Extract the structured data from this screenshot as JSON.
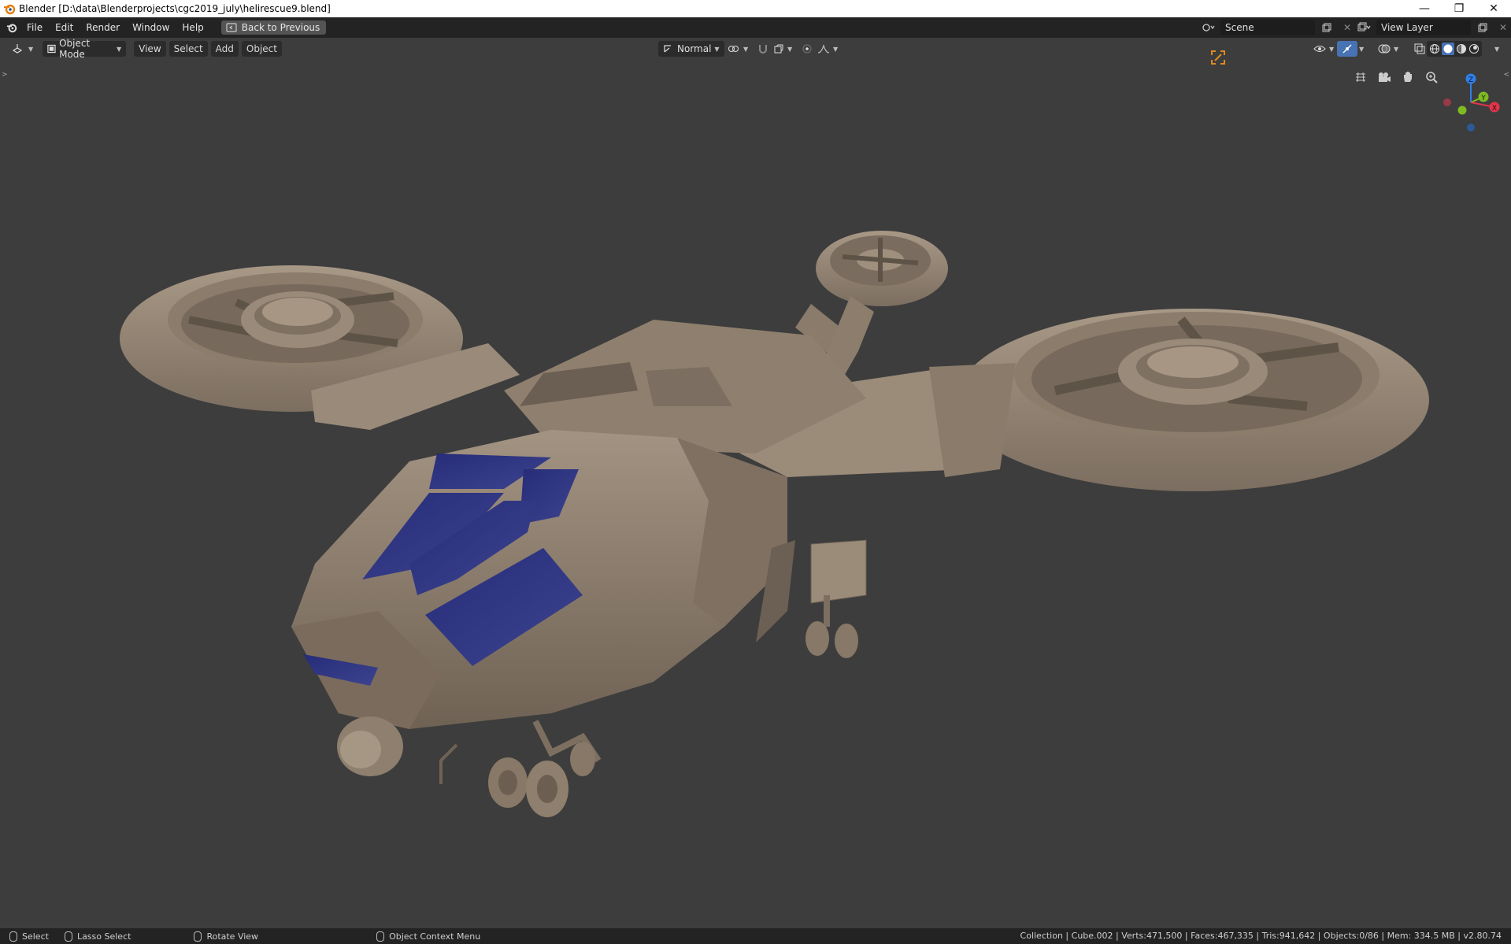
{
  "window": {
    "title": "Blender [D:\\data\\Blenderprojects\\cgc2019_july\\helirescue9.blend]",
    "controls": {
      "minimize": "—",
      "restore": "❐",
      "close": "✕"
    }
  },
  "topbar": {
    "menus": [
      "File",
      "Edit",
      "Render",
      "Window",
      "Help"
    ],
    "back_button": "Back to Previous",
    "scene_name": "Scene",
    "view_layer": "View Layer"
  },
  "viewport_header": {
    "mode": "Object Mode",
    "menus": [
      "View",
      "Select",
      "Add",
      "Object"
    ],
    "orientation": "Normal"
  },
  "gizmo": {
    "z": "Z",
    "y": "Y",
    "x": "X"
  },
  "statusbar": {
    "select": "Select",
    "lasso": "Lasso Select",
    "rotate": "Rotate View",
    "context": "Object Context Menu",
    "stats": "Collection | Cube.002 | Verts:471,500 | Faces:467,335 | Tris:941,642 | Objects:0/86 | Mem: 334.5 MB | v2.80.74"
  },
  "colors": {
    "hull": "#8f7f6e",
    "glass": "#2f3583",
    "accent_orange": "#e08a1e",
    "axis_x": "#e2354a",
    "axis_y": "#7fba22",
    "axis_z": "#2f7fe8"
  }
}
